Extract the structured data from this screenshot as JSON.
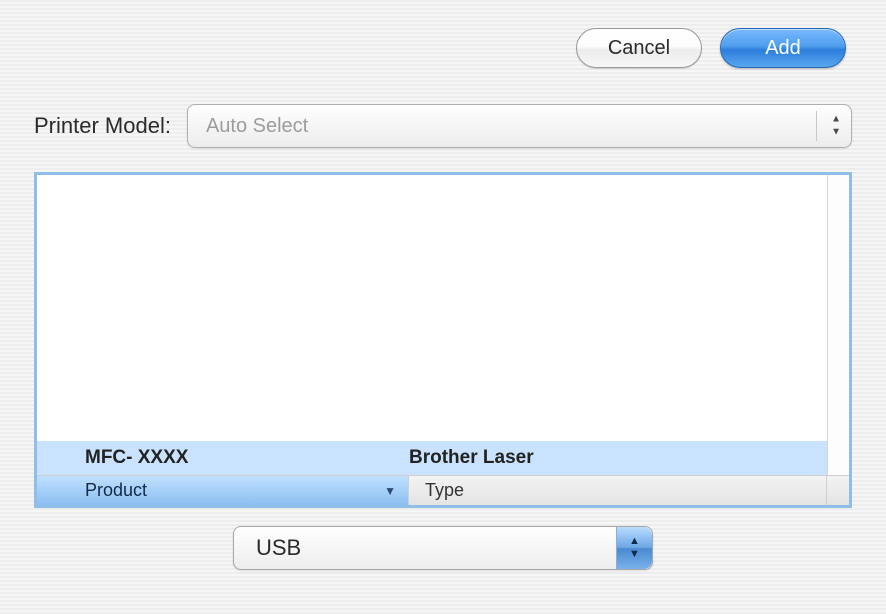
{
  "buttons": {
    "cancel": "Cancel",
    "add": "Add"
  },
  "printer_model": {
    "label": "Printer Model:",
    "value": "Auto Select"
  },
  "table": {
    "headers": {
      "product": "Product",
      "type": "Type"
    },
    "rows": [
      {
        "product": "MFC- XXXX",
        "type": "Brother Laser"
      }
    ]
  },
  "connection": {
    "value": "USB"
  }
}
